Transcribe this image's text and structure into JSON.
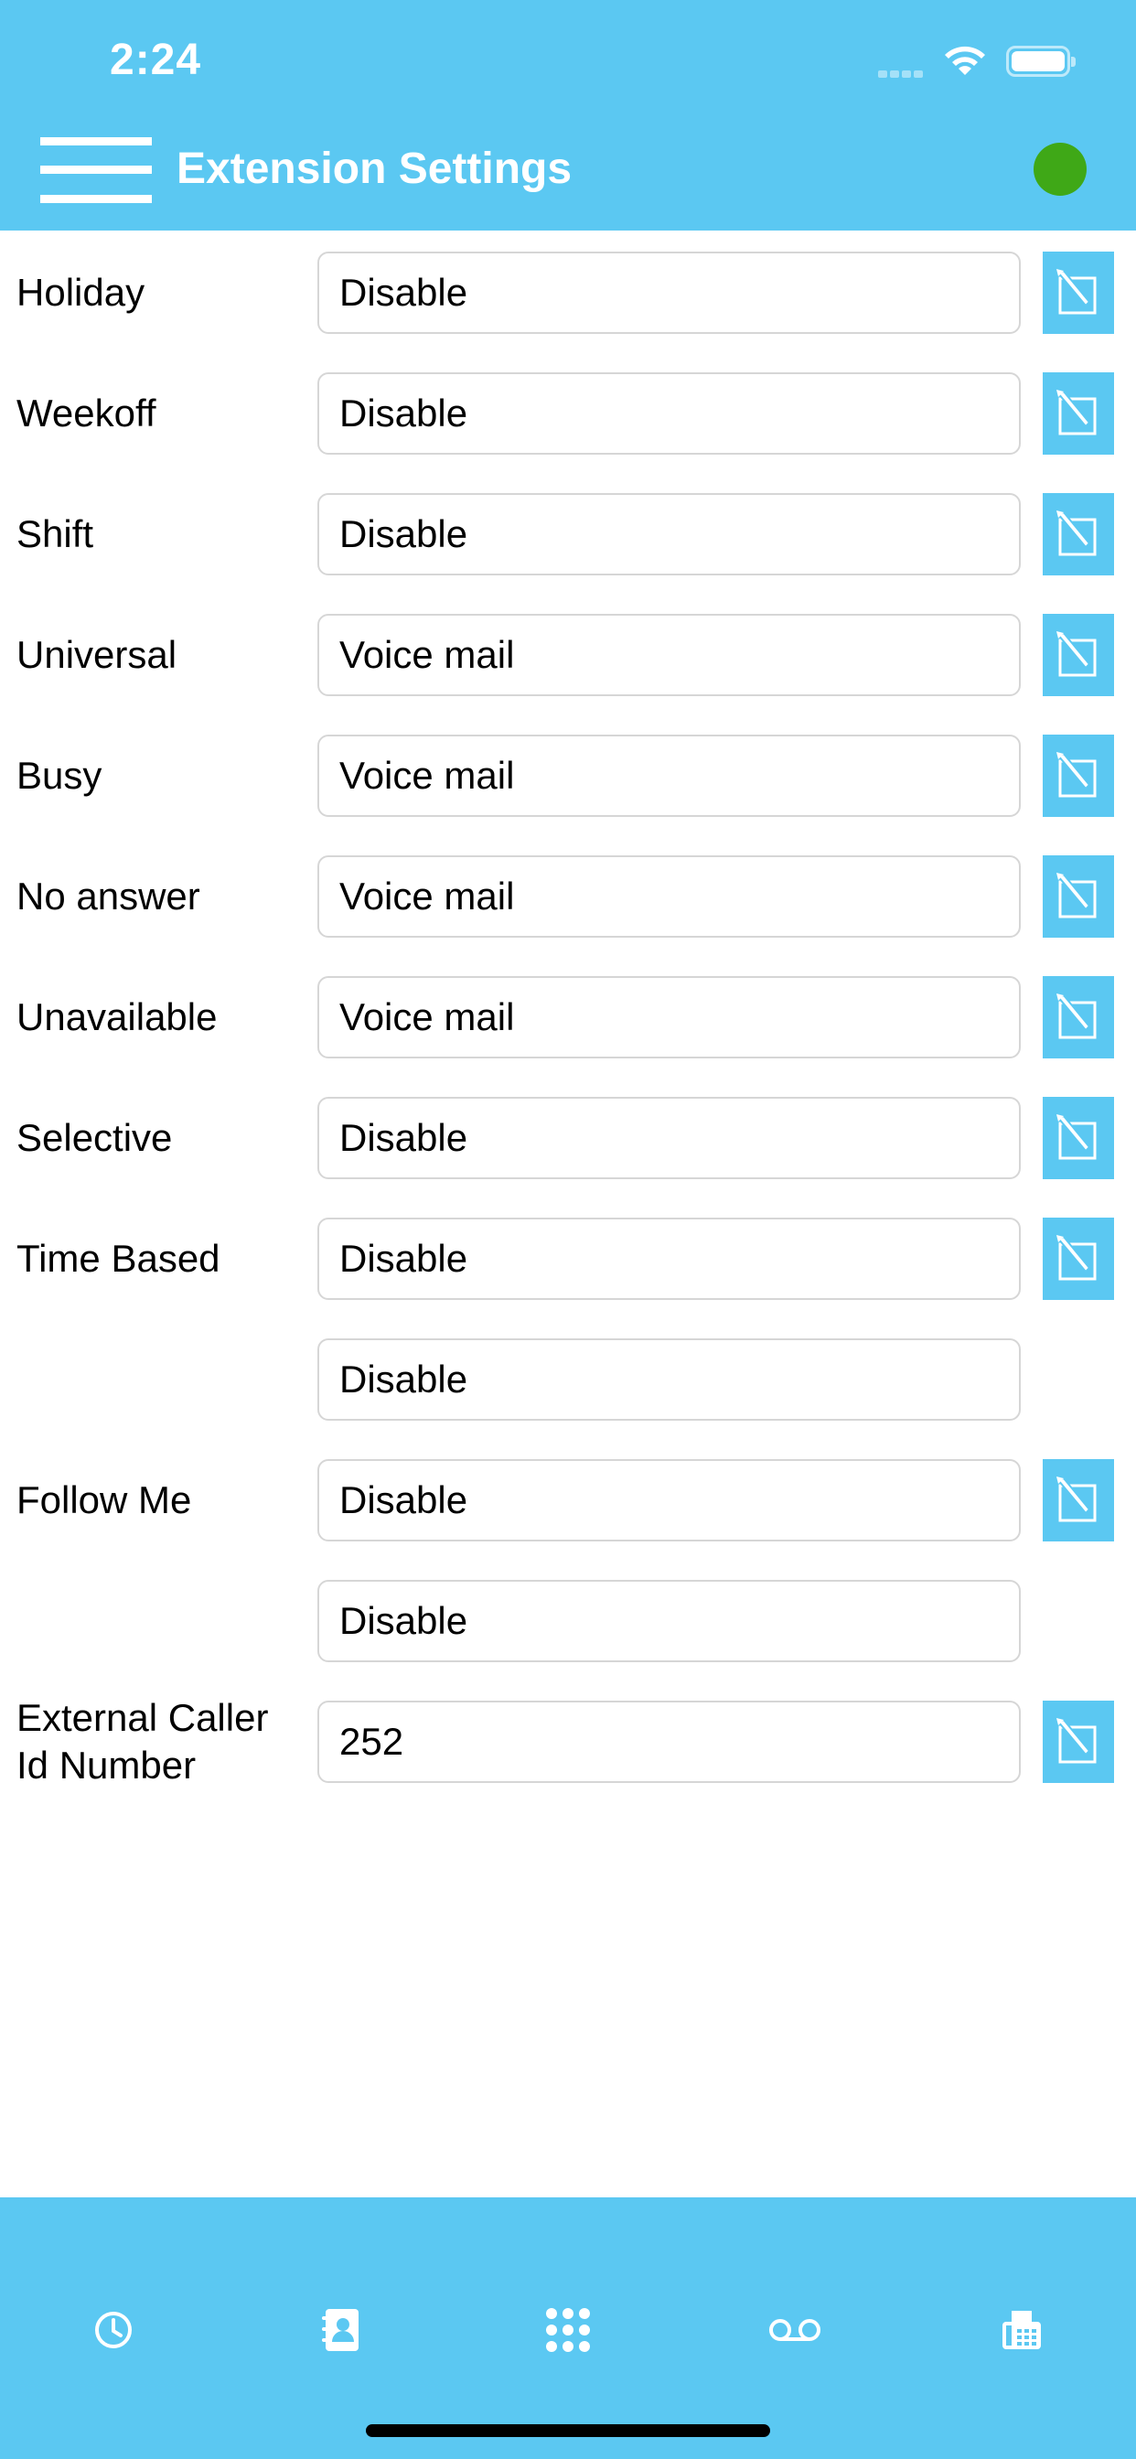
{
  "status_bar": {
    "time": "2:24"
  },
  "header": {
    "title": "Extension Settings",
    "status_color": "#3fa817",
    "accent": "#5bc8f2"
  },
  "settings": [
    {
      "label": "Holiday",
      "value": "Disable",
      "editable": true
    },
    {
      "label": "Weekoff",
      "value": "Disable",
      "editable": true
    },
    {
      "label": "Shift",
      "value": "Disable",
      "editable": true
    },
    {
      "label": "Universal",
      "value": "Voice mail",
      "editable": true
    },
    {
      "label": "Busy",
      "value": "Voice mail",
      "editable": true
    },
    {
      "label": "No answer",
      "value": "Voice mail",
      "editable": true
    },
    {
      "label": "Unavailable",
      "value": "Voice mail",
      "editable": true
    },
    {
      "label": "Selective",
      "value": "Disable",
      "editable": true
    },
    {
      "label": "Time Based",
      "value": "Disable",
      "editable": true
    },
    {
      "label": "",
      "value": "Disable",
      "editable": false
    },
    {
      "label": "Follow Me",
      "value": "Disable",
      "editable": true
    },
    {
      "label": "",
      "value": "Disable",
      "editable": false
    },
    {
      "label": "External Caller Id Number",
      "value": "252",
      "editable": true
    }
  ],
  "tab_bar": {
    "tabs": [
      {
        "icon": "clock-icon"
      },
      {
        "icon": "contacts-icon"
      },
      {
        "icon": "keypad-icon"
      },
      {
        "icon": "voicemail-icon"
      },
      {
        "icon": "fax-icon"
      }
    ]
  }
}
